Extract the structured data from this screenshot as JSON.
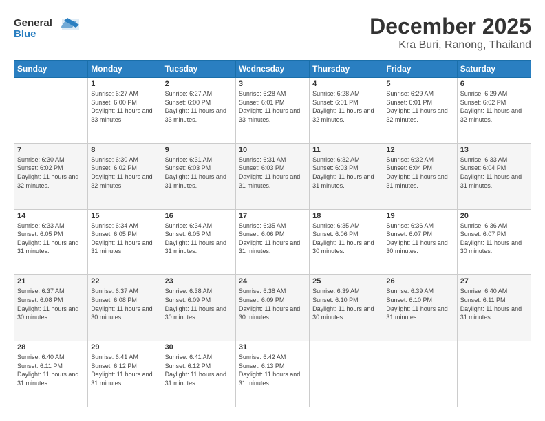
{
  "logo": {
    "line1": "General",
    "line2": "Blue"
  },
  "header": {
    "month": "December 2025",
    "location": "Kra Buri, Ranong, Thailand"
  },
  "weekdays": [
    "Sunday",
    "Monday",
    "Tuesday",
    "Wednesday",
    "Thursday",
    "Friday",
    "Saturday"
  ],
  "weeks": [
    [
      {
        "day": "",
        "sunrise": "",
        "sunset": "",
        "daylight": ""
      },
      {
        "day": "1",
        "sunrise": "Sunrise: 6:27 AM",
        "sunset": "Sunset: 6:00 PM",
        "daylight": "Daylight: 11 hours and 33 minutes."
      },
      {
        "day": "2",
        "sunrise": "Sunrise: 6:27 AM",
        "sunset": "Sunset: 6:00 PM",
        "daylight": "Daylight: 11 hours and 33 minutes."
      },
      {
        "day": "3",
        "sunrise": "Sunrise: 6:28 AM",
        "sunset": "Sunset: 6:01 PM",
        "daylight": "Daylight: 11 hours and 33 minutes."
      },
      {
        "day": "4",
        "sunrise": "Sunrise: 6:28 AM",
        "sunset": "Sunset: 6:01 PM",
        "daylight": "Daylight: 11 hours and 32 minutes."
      },
      {
        "day": "5",
        "sunrise": "Sunrise: 6:29 AM",
        "sunset": "Sunset: 6:01 PM",
        "daylight": "Daylight: 11 hours and 32 minutes."
      },
      {
        "day": "6",
        "sunrise": "Sunrise: 6:29 AM",
        "sunset": "Sunset: 6:02 PM",
        "daylight": "Daylight: 11 hours and 32 minutes."
      }
    ],
    [
      {
        "day": "7",
        "sunrise": "Sunrise: 6:30 AM",
        "sunset": "Sunset: 6:02 PM",
        "daylight": "Daylight: 11 hours and 32 minutes."
      },
      {
        "day": "8",
        "sunrise": "Sunrise: 6:30 AM",
        "sunset": "Sunset: 6:02 PM",
        "daylight": "Daylight: 11 hours and 32 minutes."
      },
      {
        "day": "9",
        "sunrise": "Sunrise: 6:31 AM",
        "sunset": "Sunset: 6:03 PM",
        "daylight": "Daylight: 11 hours and 31 minutes."
      },
      {
        "day": "10",
        "sunrise": "Sunrise: 6:31 AM",
        "sunset": "Sunset: 6:03 PM",
        "daylight": "Daylight: 11 hours and 31 minutes."
      },
      {
        "day": "11",
        "sunrise": "Sunrise: 6:32 AM",
        "sunset": "Sunset: 6:03 PM",
        "daylight": "Daylight: 11 hours and 31 minutes."
      },
      {
        "day": "12",
        "sunrise": "Sunrise: 6:32 AM",
        "sunset": "Sunset: 6:04 PM",
        "daylight": "Daylight: 11 hours and 31 minutes."
      },
      {
        "day": "13",
        "sunrise": "Sunrise: 6:33 AM",
        "sunset": "Sunset: 6:04 PM",
        "daylight": "Daylight: 11 hours and 31 minutes."
      }
    ],
    [
      {
        "day": "14",
        "sunrise": "Sunrise: 6:33 AM",
        "sunset": "Sunset: 6:05 PM",
        "daylight": "Daylight: 11 hours and 31 minutes."
      },
      {
        "day": "15",
        "sunrise": "Sunrise: 6:34 AM",
        "sunset": "Sunset: 6:05 PM",
        "daylight": "Daylight: 11 hours and 31 minutes."
      },
      {
        "day": "16",
        "sunrise": "Sunrise: 6:34 AM",
        "sunset": "Sunset: 6:05 PM",
        "daylight": "Daylight: 11 hours and 31 minutes."
      },
      {
        "day": "17",
        "sunrise": "Sunrise: 6:35 AM",
        "sunset": "Sunset: 6:06 PM",
        "daylight": "Daylight: 11 hours and 31 minutes."
      },
      {
        "day": "18",
        "sunrise": "Sunrise: 6:35 AM",
        "sunset": "Sunset: 6:06 PM",
        "daylight": "Daylight: 11 hours and 30 minutes."
      },
      {
        "day": "19",
        "sunrise": "Sunrise: 6:36 AM",
        "sunset": "Sunset: 6:07 PM",
        "daylight": "Daylight: 11 hours and 30 minutes."
      },
      {
        "day": "20",
        "sunrise": "Sunrise: 6:36 AM",
        "sunset": "Sunset: 6:07 PM",
        "daylight": "Daylight: 11 hours and 30 minutes."
      }
    ],
    [
      {
        "day": "21",
        "sunrise": "Sunrise: 6:37 AM",
        "sunset": "Sunset: 6:08 PM",
        "daylight": "Daylight: 11 hours and 30 minutes."
      },
      {
        "day": "22",
        "sunrise": "Sunrise: 6:37 AM",
        "sunset": "Sunset: 6:08 PM",
        "daylight": "Daylight: 11 hours and 30 minutes."
      },
      {
        "day": "23",
        "sunrise": "Sunrise: 6:38 AM",
        "sunset": "Sunset: 6:09 PM",
        "daylight": "Daylight: 11 hours and 30 minutes."
      },
      {
        "day": "24",
        "sunrise": "Sunrise: 6:38 AM",
        "sunset": "Sunset: 6:09 PM",
        "daylight": "Daylight: 11 hours and 30 minutes."
      },
      {
        "day": "25",
        "sunrise": "Sunrise: 6:39 AM",
        "sunset": "Sunset: 6:10 PM",
        "daylight": "Daylight: 11 hours and 30 minutes."
      },
      {
        "day": "26",
        "sunrise": "Sunrise: 6:39 AM",
        "sunset": "Sunset: 6:10 PM",
        "daylight": "Daylight: 11 hours and 31 minutes."
      },
      {
        "day": "27",
        "sunrise": "Sunrise: 6:40 AM",
        "sunset": "Sunset: 6:11 PM",
        "daylight": "Daylight: 11 hours and 31 minutes."
      }
    ],
    [
      {
        "day": "28",
        "sunrise": "Sunrise: 6:40 AM",
        "sunset": "Sunset: 6:11 PM",
        "daylight": "Daylight: 11 hours and 31 minutes."
      },
      {
        "day": "29",
        "sunrise": "Sunrise: 6:41 AM",
        "sunset": "Sunset: 6:12 PM",
        "daylight": "Daylight: 11 hours and 31 minutes."
      },
      {
        "day": "30",
        "sunrise": "Sunrise: 6:41 AM",
        "sunset": "Sunset: 6:12 PM",
        "daylight": "Daylight: 11 hours and 31 minutes."
      },
      {
        "day": "31",
        "sunrise": "Sunrise: 6:42 AM",
        "sunset": "Sunset: 6:13 PM",
        "daylight": "Daylight: 11 hours and 31 minutes."
      },
      {
        "day": "",
        "sunrise": "",
        "sunset": "",
        "daylight": ""
      },
      {
        "day": "",
        "sunrise": "",
        "sunset": "",
        "daylight": ""
      },
      {
        "day": "",
        "sunrise": "",
        "sunset": "",
        "daylight": ""
      }
    ]
  ]
}
